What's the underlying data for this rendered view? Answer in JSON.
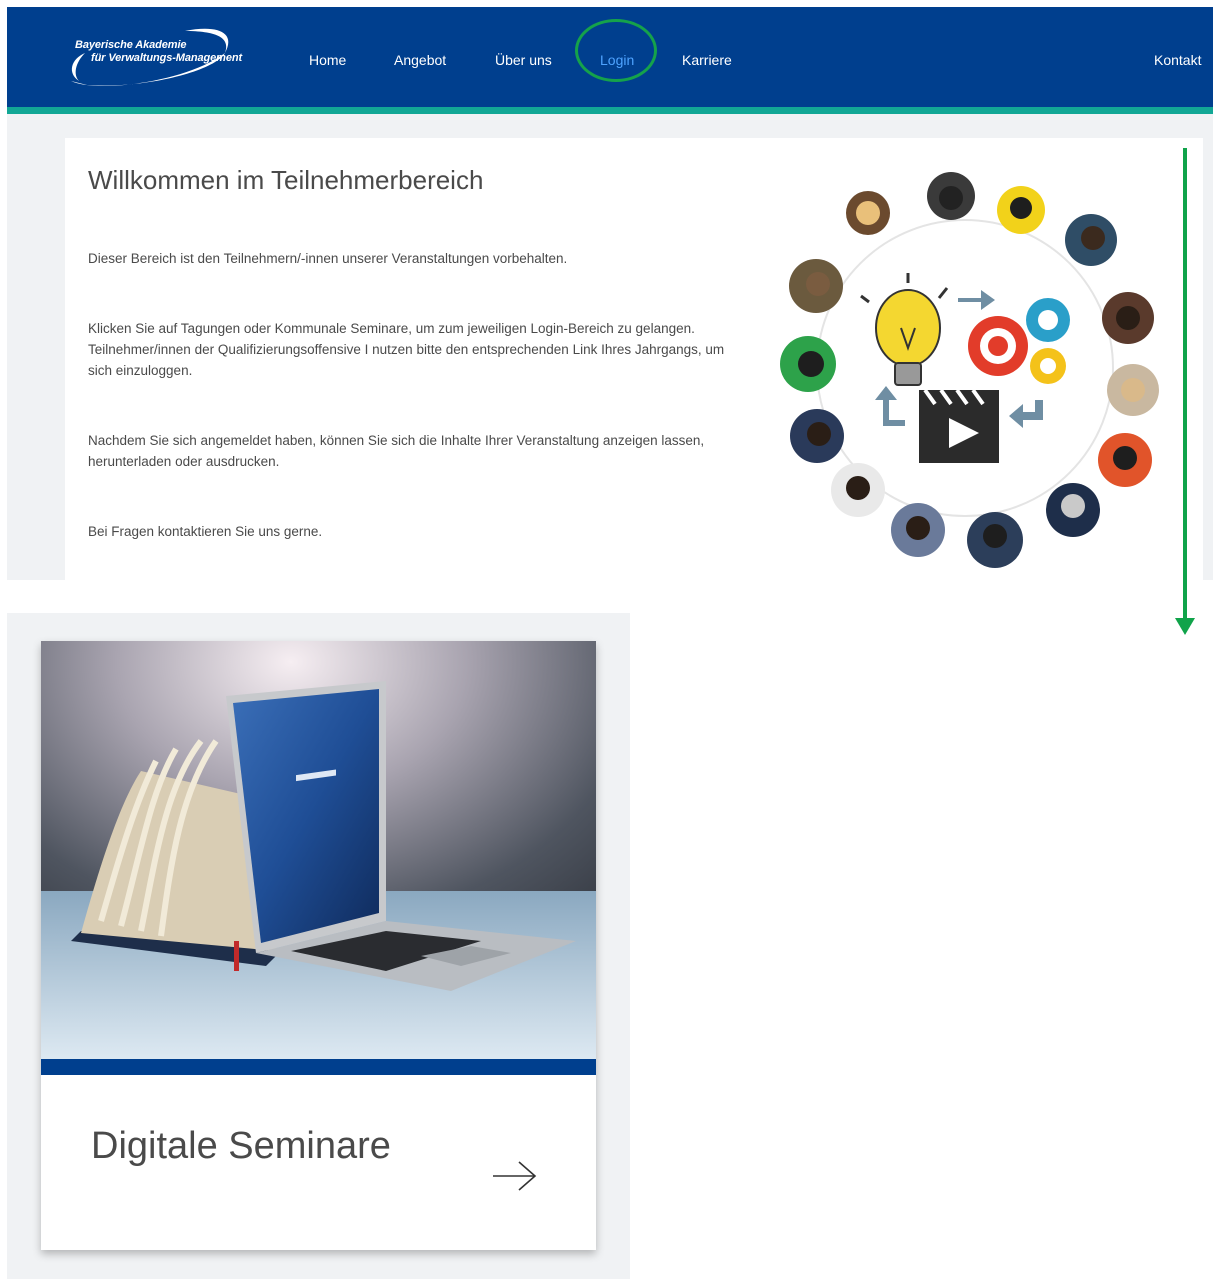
{
  "header": {
    "logo": {
      "line1": "Bayerische Akademie",
      "line2": "für Verwaltungs-Management"
    },
    "nav": [
      {
        "label": "Home"
      },
      {
        "label": "Angebot"
      },
      {
        "label": "Über uns"
      },
      {
        "label": "Login"
      },
      {
        "label": "Karriere"
      }
    ],
    "contact_label": "Kontakt"
  },
  "main": {
    "title": "Willkommen im Teilnehmerbereich",
    "paragraphs": [
      "Dieser Bereich ist den Teilnehmern/-innen unserer Veranstaltungen vorbehalten.",
      "Klicken Sie auf Tagungen oder Kommunale Seminare, um zum jeweiligen Login-Bereich zu gelangen. Teilnehmer/innen der Qualifizierungsoffensive I nutzen bitte den entsprechenden Link Ihres Jahrgangs, um sich einzuloggen.",
      "Nachdem Sie sich angemeldet haben, können Sie sich die Inhalte Ihrer Veranstaltung anzeigen lassen, herunterladen oder ausdrucken.",
      "Bei Fragen kontaktieren Sie uns gerne."
    ]
  },
  "tile": {
    "title": "Digitale Seminare"
  },
  "colors": {
    "header_blue": "#003f8e",
    "accent_teal": "#12a795",
    "annotation_green": "#15a24b",
    "login_link": "#4ea3ff"
  },
  "icons": [
    "lightbulb-icon",
    "gear-icon",
    "play-button-icon",
    "arrow-right-icon"
  ]
}
